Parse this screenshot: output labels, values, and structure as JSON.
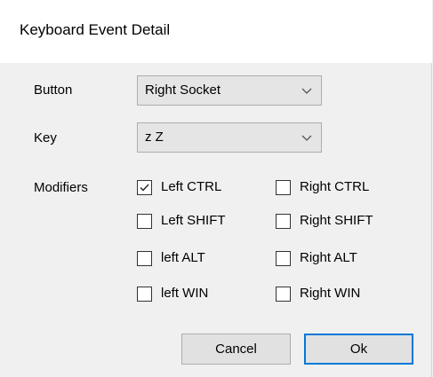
{
  "window": {
    "title": "Keyboard Event Detail"
  },
  "form": {
    "button_label": "Button",
    "button_value": "Right Socket",
    "key_label": "Key",
    "key_value": "z Z",
    "modifiers_label": "Modifiers"
  },
  "modifiers": {
    "left_ctrl": {
      "label": "Left CTRL",
      "checked": true
    },
    "right_ctrl": {
      "label": "Right CTRL",
      "checked": false
    },
    "left_shift": {
      "label": "Left SHIFT",
      "checked": false
    },
    "right_shift": {
      "label": "Right SHIFT",
      "checked": false
    },
    "left_alt": {
      "label": "left ALT",
      "checked": false
    },
    "right_alt": {
      "label": "Right ALT",
      "checked": false
    },
    "left_win": {
      "label": "left WIN",
      "checked": false
    },
    "right_win": {
      "label": "Right WIN",
      "checked": false
    }
  },
  "actions": {
    "cancel_label": "Cancel",
    "ok_label": "Ok"
  },
  "colors": {
    "dialog_background": "#f0f0f0",
    "title_background": "#ffffff",
    "default_button_border": "#0078d7"
  },
  "icons": {
    "dropdown": "chevron-down-icon",
    "checkmark": "checkmark-icon"
  }
}
